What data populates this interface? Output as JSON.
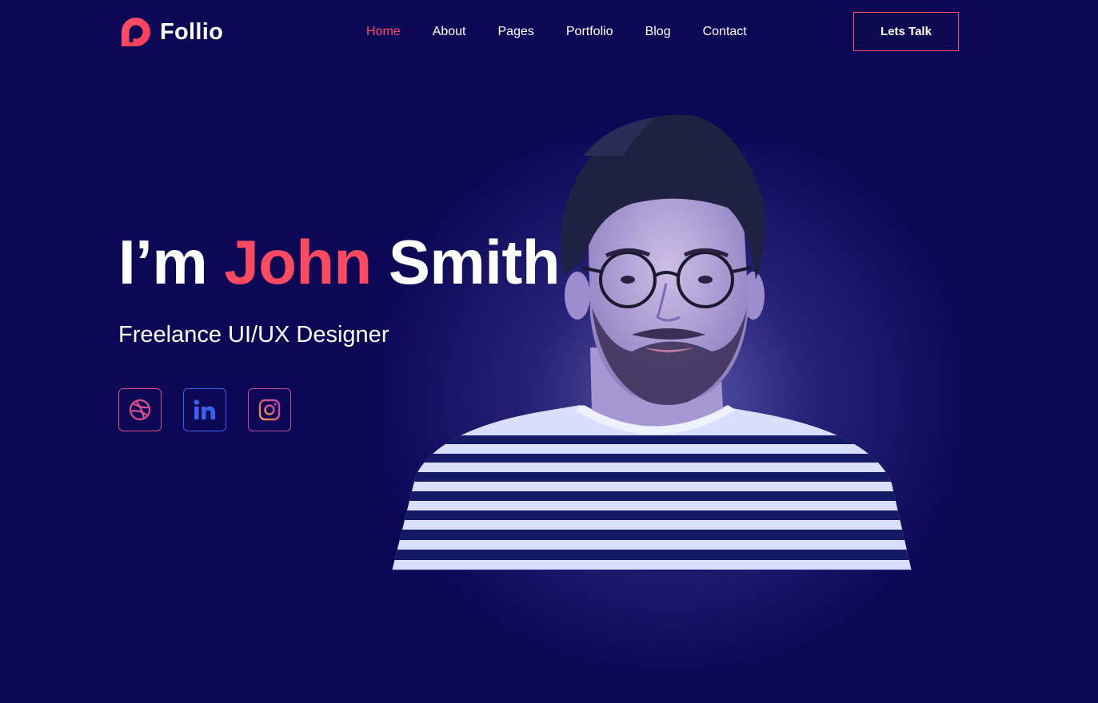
{
  "header": {
    "brand": "Follio",
    "nav": [
      {
        "label": "Home",
        "active": true
      },
      {
        "label": "About",
        "active": false
      },
      {
        "label": "Pages",
        "active": false
      },
      {
        "label": "Portfolio",
        "active": false
      },
      {
        "label": "Blog",
        "active": false
      },
      {
        "label": "Contact",
        "active": false
      }
    ],
    "cta_label": "Lets Talk"
  },
  "hero": {
    "greeting": "I’m",
    "first_name": "John",
    "last_name": "Smith",
    "subtitle": "Freelance UI/UX Designer",
    "socials": [
      {
        "icon": "dribbble-icon"
      },
      {
        "icon": "linkedin-icon"
      },
      {
        "icon": "instagram-icon"
      }
    ]
  },
  "colors": {
    "background": "#0c0856",
    "accent": "#ff4a60",
    "linkedin": "#3a62e8"
  }
}
